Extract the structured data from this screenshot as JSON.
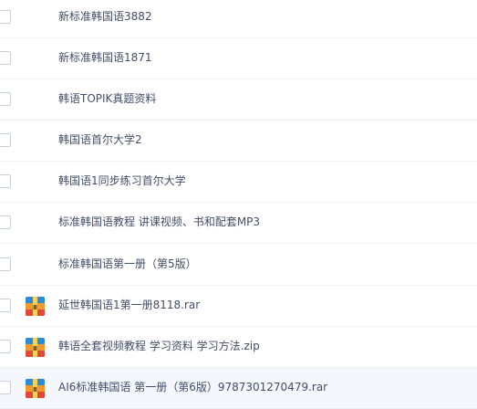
{
  "files": [
    {
      "name": "新标准韩国语3882",
      "type": "folder"
    },
    {
      "name": "新标准韩国语1871",
      "type": "folder"
    },
    {
      "name": "韩语TOPIK真题资料",
      "type": "folder"
    },
    {
      "name": "韩国语首尔大学2",
      "type": "folder"
    },
    {
      "name": "韩国语1同步练习首尔大学",
      "type": "folder"
    },
    {
      "name": "标准韩国语教程 讲课视频、书和配套MP3",
      "type": "folder"
    },
    {
      "name": "标准韩国语第一册（第5版）",
      "type": "folder"
    },
    {
      "name": "延世韩国语1第一册8118.rar",
      "type": "archive",
      "icon": "archive-icon"
    },
    {
      "name": "韩语全套视频教程 学习资料 学习方法.zip",
      "type": "archive",
      "icon": "archive-icon"
    },
    {
      "name": "AI6标准韩国语 第一册（第6版）9787301270479.rar",
      "type": "archive",
      "icon": "archive-icon"
    }
  ],
  "colors": {
    "text": "#424e67",
    "hover_row": "#f4f8fe",
    "archive_green": "#4aa844",
    "archive_orange": "#f29a2e",
    "archive_blue": "#2e8bd9",
    "archive_red": "#e0493a"
  }
}
